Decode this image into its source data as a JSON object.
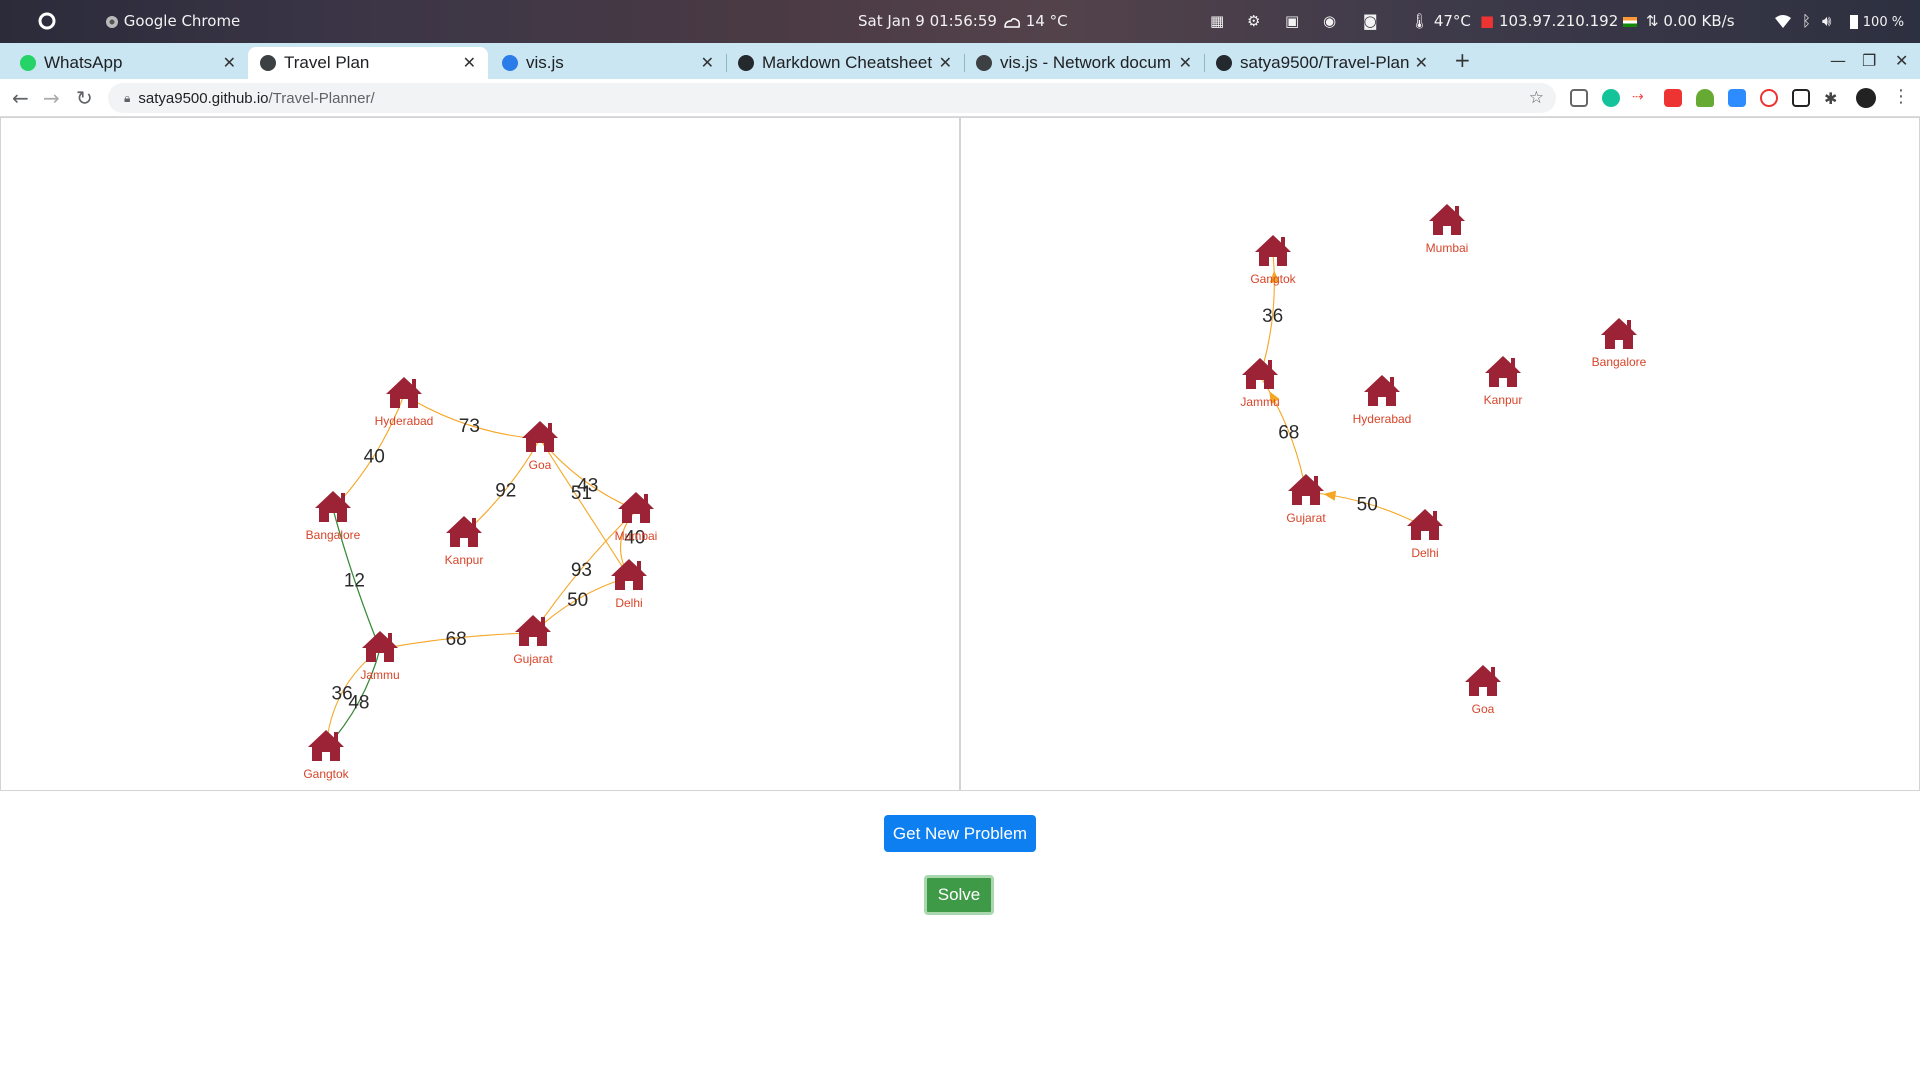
{
  "os_bar": {
    "app_name": "Google Chrome",
    "datetime": "Sat Jan 9  01:56:59",
    "weather": "14 °C",
    "cpu_temp": "47°C",
    "ip": "103.97.210.192",
    "net_speed": "0.00 KB/s",
    "battery": "100 %"
  },
  "tabs": [
    {
      "title": "WhatsApp",
      "favicon_color": "#25d366",
      "active": false
    },
    {
      "title": "Travel Plan",
      "favicon_color": "#3c4043",
      "active": true
    },
    {
      "title": "vis.js",
      "favicon_color": "#2b7ce9",
      "active": false
    },
    {
      "title": "Markdown Cheatsheet",
      "favicon_color": "#24292e",
      "active": false
    },
    {
      "title": "vis.js - Network docum",
      "favicon_color": "#3c4043",
      "active": false
    },
    {
      "title": "satya9500/Travel-Plan",
      "favicon_color": "#24292e",
      "active": false
    }
  ],
  "address": {
    "host": "satya9500.github.io",
    "path": "/Travel-Planner/"
  },
  "colors": {
    "node": "#9b2335",
    "node_label": "#d6452a",
    "edge": "#f5a623",
    "edge_solution": "#3a8a3a",
    "primary_button": "#0d7ff0",
    "success_button": "#3f9a47"
  },
  "problem_graph": {
    "nodes": [
      {
        "id": "Hyderabad",
        "label": "Hyderabad"
      },
      {
        "id": "Goa",
        "label": "Goa"
      },
      {
        "id": "Bangalore",
        "label": "Bangalore"
      },
      {
        "id": "Kanpur",
        "label": "Kanpur"
      },
      {
        "id": "Mumbai",
        "label": "Mumbai"
      },
      {
        "id": "Delhi",
        "label": "Delhi"
      },
      {
        "id": "Jammu",
        "label": "Jammu"
      },
      {
        "id": "Gujarat",
        "label": "Gujarat"
      },
      {
        "id": "Gangtok",
        "label": "Gangtok"
      }
    ],
    "edges": [
      {
        "from": "Hyderabad",
        "to": "Goa",
        "label": "73",
        "highlight": false
      },
      {
        "from": "Hyderabad",
        "to": "Bangalore",
        "label": "40",
        "highlight": false
      },
      {
        "from": "Goa",
        "to": "Kanpur",
        "label": "92",
        "highlight": false
      },
      {
        "from": "Goa",
        "to": "Mumbai",
        "label": "43",
        "highlight": false
      },
      {
        "from": "Goa",
        "to": "Delhi",
        "label": "51",
        "highlight": false
      },
      {
        "from": "Mumbai",
        "to": "Delhi",
        "label": "40",
        "highlight": false
      },
      {
        "from": "Mumbai",
        "to": "Gujarat",
        "label": "93",
        "highlight": false
      },
      {
        "from": "Delhi",
        "to": "Gujarat",
        "label": "50",
        "highlight": false
      },
      {
        "from": "Gujarat",
        "to": "Jammu",
        "label": "68",
        "highlight": false
      },
      {
        "from": "Bangalore",
        "to": "Jammu",
        "label": "12",
        "highlight": true
      },
      {
        "from": "Jammu",
        "to": "Gangtok",
        "label": "36",
        "highlight": false
      },
      {
        "from": "Jammu",
        "to": "Gangtok",
        "label": "48",
        "highlight": true
      }
    ]
  },
  "solution_graph": {
    "nodes": [
      {
        "id": "Mumbai",
        "label": "Mumbai"
      },
      {
        "id": "Gangtok",
        "label": "Gangtok"
      },
      {
        "id": "Bangalore",
        "label": "Bangalore"
      },
      {
        "id": "Kanpur",
        "label": "Kanpur"
      },
      {
        "id": "Jammu",
        "label": "Jammu"
      },
      {
        "id": "Hyderabad",
        "label": "Hyderabad"
      },
      {
        "id": "Gujarat",
        "label": "Gujarat"
      },
      {
        "id": "Delhi",
        "label": "Delhi"
      },
      {
        "id": "Goa",
        "label": "Goa"
      }
    ],
    "edges": [
      {
        "from": "Delhi",
        "to": "Gujarat",
        "label": "50"
      },
      {
        "from": "Gujarat",
        "to": "Jammu",
        "label": "68"
      },
      {
        "from": "Jammu",
        "to": "Gangtok",
        "label": "36"
      }
    ]
  },
  "buttons": {
    "new_problem": "Get New Problem",
    "solve": "Solve"
  }
}
